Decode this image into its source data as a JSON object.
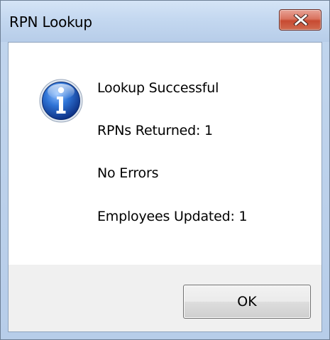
{
  "window": {
    "title": "RPN Lookup",
    "close_icon": "close-x-icon"
  },
  "dialog": {
    "icon": "information-icon",
    "messages": [
      "Lookup Successful",
      "RPNs Returned: 1",
      "No Errors",
      "Employees Updated: 1"
    ],
    "ok_label": "OK"
  },
  "colors": {
    "close_button": "#c74a32",
    "info_icon": "#1f5fbf"
  }
}
